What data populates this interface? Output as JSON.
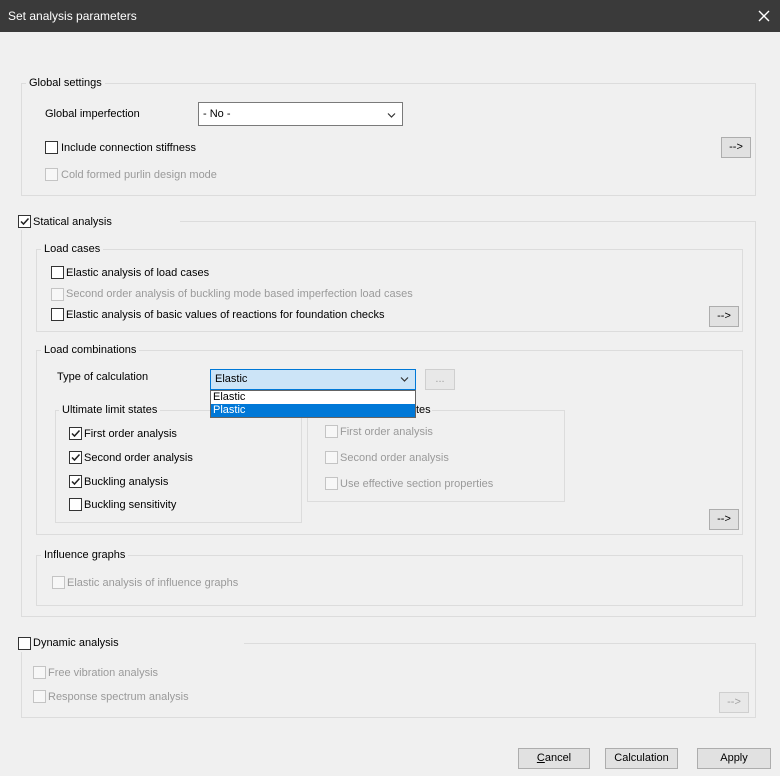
{
  "window": {
    "title": "Set analysis parameters"
  },
  "global_settings": {
    "title": "Global settings",
    "imperfection_label": "Global imperfection",
    "imperfection_value": "- No -",
    "connection_stiffness_label": "Include connection stiffness",
    "connection_stiffness_checked": false,
    "purlin_label": "Cold formed purlin design mode",
    "arrow_button": "-->"
  },
  "statical": {
    "label": "Statical analysis",
    "checked": true,
    "load_cases": {
      "title": "Load cases",
      "elastic_label": "Elastic analysis of load cases",
      "second_order_label": "Second order analysis of buckling mode based imperfection load cases",
      "reactions_label": "Elastic analysis of basic values of reactions for foundation checks",
      "arrow_button": "-->"
    },
    "load_combinations": {
      "title": "Load combinations",
      "type_label": "Type of calculation",
      "type_value": "Elastic",
      "type_options": [
        "Elastic",
        "Plastic"
      ],
      "ellipsis_button": "...",
      "uls": {
        "title": "Ultimate limit states",
        "first_order": "First order analysis",
        "second_order": "Second order analysis",
        "buckling": "Buckling analysis",
        "buckling_sensitivity": "Buckling sensitivity"
      },
      "sls": {
        "title_fragment": "tes",
        "first_order": "First order analysis",
        "second_order": "Second order analysis",
        "effective": "Use effective section properties"
      },
      "arrow_button": "-->"
    },
    "influence": {
      "title": "Influence graphs",
      "elastic_label": "Elastic analysis of influence graphs"
    }
  },
  "dynamic": {
    "label": "Dynamic analysis",
    "checked": false,
    "free_vibration": "Free vibration analysis",
    "response_spectrum": "Response spectrum analysis",
    "arrow_button": "-->"
  },
  "footer": {
    "cancel_prefix": "C",
    "cancel_rest": "ancel",
    "calculation": "Calculation",
    "apply": "Apply"
  }
}
